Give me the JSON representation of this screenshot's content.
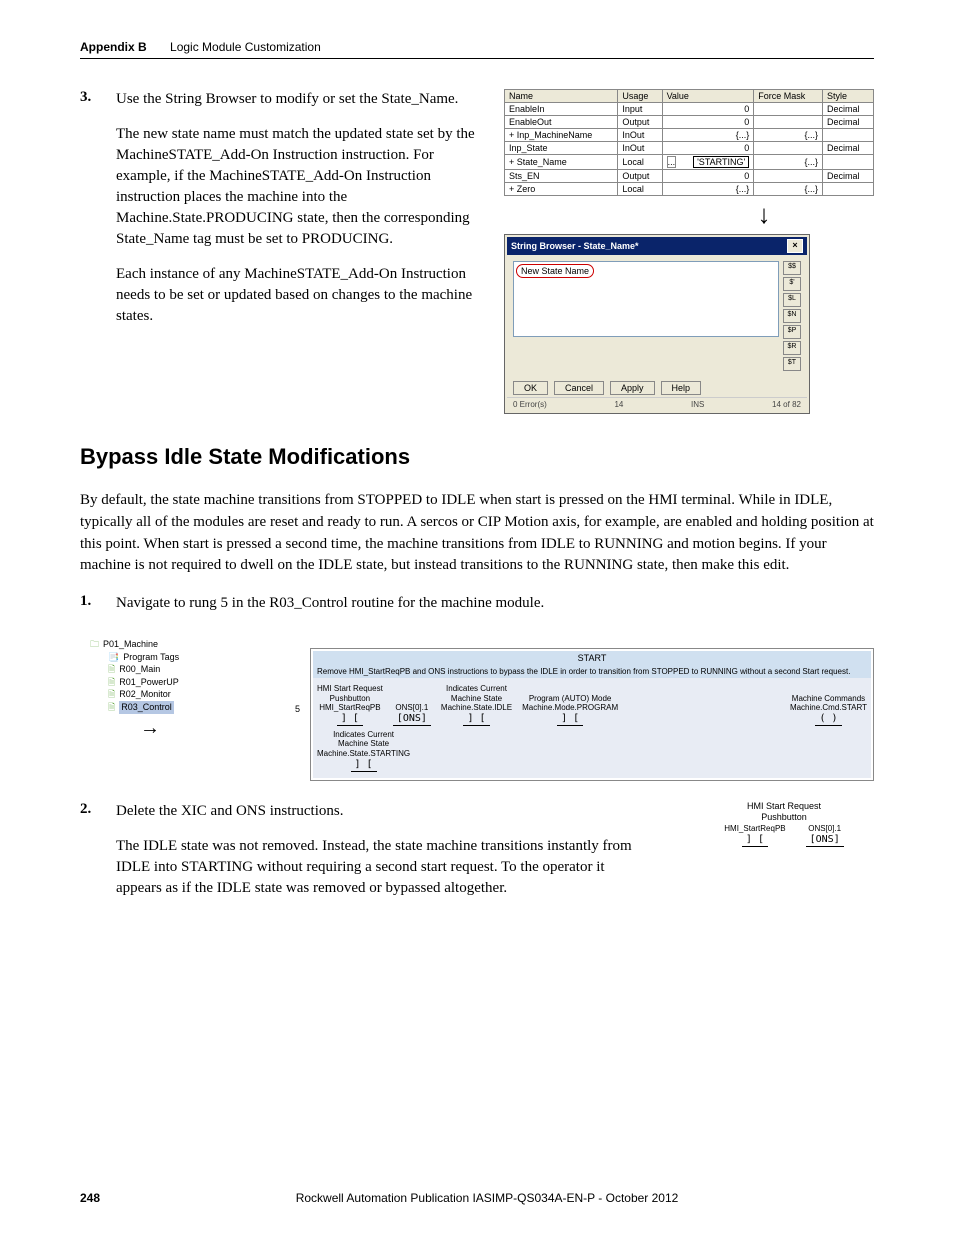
{
  "header": {
    "appendix": "Appendix B",
    "chapter_title": "Logic Module Customization"
  },
  "step3": {
    "num": "3.",
    "p1": "Use the String Browser to modify or set the State_Name.",
    "p2": "The new state name must match the updated state set by the MachineSTATE_Add-On Instruction instruction. For example, if the MachineSTATE_Add-On Instruction instruction places the machine into the Machine.State.PRODUCING state, then the corresponding State_Name tag must be set to PRODUCING.",
    "p3": "Each instance of any MachineSTATE_Add-On Instruction needs to be set or updated based on changes to the machine states."
  },
  "tag_table": {
    "headers": [
      "Name",
      "Usage",
      "Value",
      "Force Mask",
      "Style"
    ],
    "rows": [
      {
        "name": "EnableIn",
        "usage": "Input",
        "value": "0",
        "mask": "",
        "style": "Decimal"
      },
      {
        "name": "EnableOut",
        "usage": "Output",
        "value": "0",
        "mask": "",
        "style": "Decimal"
      },
      {
        "name": "+ Inp_MachineName",
        "usage": "InOut",
        "value": "{...}",
        "mask": "{...}",
        "style": ""
      },
      {
        "name": "Inp_State",
        "usage": "InOut",
        "value": "0",
        "mask": "",
        "style": "Decimal"
      },
      {
        "name": "+ State_Name",
        "usage": "Local",
        "value": "'STARTING'",
        "mask": "{...}",
        "style": ""
      },
      {
        "name": "Sts_EN",
        "usage": "Output",
        "value": "0",
        "mask": "",
        "style": "Decimal"
      },
      {
        "name": "+ Zero",
        "usage": "Local",
        "value": "{...}",
        "mask": "{...}",
        "style": ""
      }
    ]
  },
  "string_browser": {
    "title": "String Browser - State_Name*",
    "input_value": "New State Name",
    "side_buttons": [
      "$$",
      "$'",
      "$L",
      "$N",
      "$P",
      "$R",
      "$T"
    ],
    "ok": "OK",
    "cancel": "Cancel",
    "apply": "Apply",
    "help": "Help",
    "status_errors": "0 Error(s)",
    "status_count": "14",
    "status_ins": "INS",
    "status_pos": "14 of 82"
  },
  "section_heading": "Bypass Idle State Modifications",
  "bypass_para": "By default, the state machine transitions from STOPPED to IDLE when start is pressed on the HMI terminal. While in IDLE, typically all of the modules are reset and ready to run. A sercos or CIP Motion axis, for example, are enabled and holding position at this point. When start is pressed a second time, the machine transitions from IDLE to RUNNING and motion begins. If your machine is not required to dwell on the IDLE state, but instead transitions to the RUNNING state, then make this edit.",
  "step1": {
    "num": "1.",
    "text": "Navigate to rung 5 in the R03_Control routine for the machine module."
  },
  "tree": {
    "items": [
      {
        "label": "P01_Machine",
        "cls": "ico-prog"
      },
      {
        "label": "Program Tags",
        "cls": "ico-tags indent1"
      },
      {
        "label": "R00_Main",
        "cls": "ico-routine indent1"
      },
      {
        "label": "R01_PowerUP",
        "cls": "ico-routine indent1"
      },
      {
        "label": "R02_Monitor",
        "cls": "ico-routine indent1"
      },
      {
        "label": "R03_Control",
        "cls": "ico-routine indent1",
        "selected": true
      }
    ]
  },
  "ladder": {
    "rung_num": "5",
    "header": "START",
    "note": "Remove HMI_StartReqPB and ONS instructions to bypass the IDLE in order to transition from STOPPED to RUNNING without a second Start request.",
    "row1": [
      {
        "lines": [
          "HMI Start Request",
          "Pushbutton",
          "HMI_StartReqPB"
        ],
        "glyph": "] ["
      },
      {
        "lines": [
          "",
          "",
          "ONS[0].1"
        ],
        "glyph": "[ONS]"
      },
      {
        "lines": [
          "Indicates Current",
          "Machine State",
          "Machine.State.IDLE"
        ],
        "glyph": "] ["
      },
      {
        "lines": [
          "",
          "Program (AUTO) Mode",
          "Machine.Mode.PROGRAM"
        ],
        "glyph": "] ["
      },
      {
        "lines": [
          "",
          "Machine Commands",
          "Machine.Cmd.START"
        ],
        "glyph": "( )"
      }
    ],
    "row2": [
      {
        "lines": [
          "Indicates Current",
          "Machine State",
          "Machine.State.STARTING"
        ],
        "glyph": "] ["
      }
    ]
  },
  "step2": {
    "num": "2.",
    "p1": "Delete the XIC and ONS instructions.",
    "p2": "The IDLE state was not removed. Instead, the state machine transitions instantly from IDLE into STARTING without requiring a second start request. To the operator it appears as if the IDLE state was removed or bypassed altogether."
  },
  "snippet": {
    "title_lines": [
      "HMI Start Request",
      "Pushbutton"
    ],
    "elems": [
      {
        "label": "HMI_StartReqPB",
        "glyph": "] ["
      },
      {
        "label": "ONS[0].1",
        "glyph": "[ONS]"
      }
    ]
  },
  "footer": {
    "page": "248",
    "publication": "Rockwell Automation Publication IASIMP-QS034A-EN-P - October 2012"
  }
}
